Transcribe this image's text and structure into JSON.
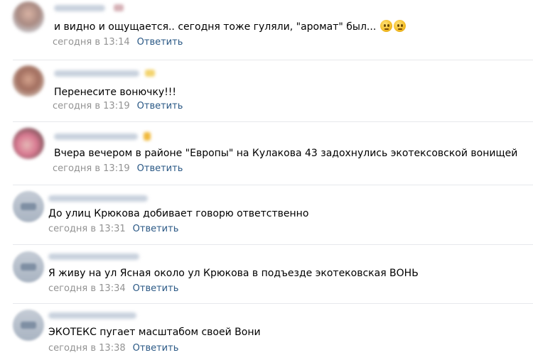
{
  "comments": [
    {
      "text": "и видно и ощущается.. сегодня тоже гуляли, \"аромат\" был...",
      "emojis": [
        "thinking-face-emoji",
        "thinking-face-emoji"
      ],
      "date": "сегодня в 13:14",
      "reply": "Ответить"
    },
    {
      "text": "Перенесите вонючку!!!",
      "date": "сегодня в 13:19",
      "reply": "Ответить"
    },
    {
      "text": "Вчера вечером в районе \"Европы\" на Кулакова 43 задохнулись экотексовской вонищей",
      "date": "сегодня в 13:19",
      "reply": "Ответить"
    },
    {
      "text": "До улиц Крюкова добивает говорю ответственно",
      "date": "сегодня в 13:31",
      "reply": "Ответить"
    },
    {
      "text": "Я живу на ул Ясная около ул Крюкова в подъезде экотековская ВОНЬ",
      "date": "сегодня в 13:34",
      "reply": "Ответить"
    },
    {
      "text": "ЭКОТЕКС пугает масштабом своей Вони",
      "date": "сегодня в 13:38",
      "reply": "Ответить"
    }
  ],
  "colors": {
    "link": "#2a5885",
    "date": "#939393",
    "divider": "#e7e8ec"
  }
}
